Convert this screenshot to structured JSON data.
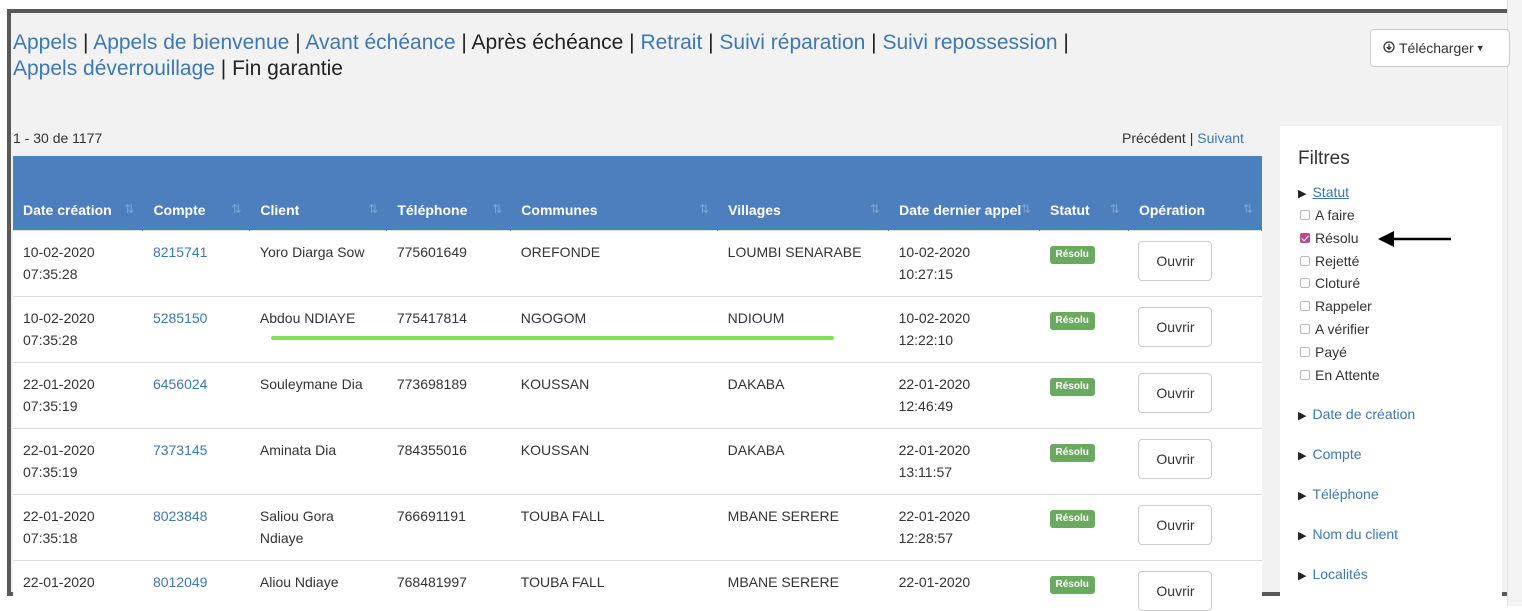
{
  "nav": {
    "items": [
      {
        "label": "Appels",
        "active": false
      },
      {
        "label": "Appels de bienvenue",
        "active": false
      },
      {
        "label": "Avant échéance",
        "active": false
      },
      {
        "label": "Après échéance",
        "active": true
      },
      {
        "label": "Retrait",
        "active": false
      },
      {
        "label": "Suivi réparation",
        "active": false
      },
      {
        "label": "Suivi repossession",
        "active": false
      },
      {
        "label": "Appels déverrouillage",
        "active": false
      },
      {
        "label": "Fin garantie",
        "active": true
      }
    ]
  },
  "download": {
    "label": "Télécharger"
  },
  "pagination": {
    "range": "1 - 30 de 1177",
    "prev": "Précédent",
    "sep": "|",
    "next": "Suivant"
  },
  "table": {
    "headers": [
      "Date création",
      "Compte",
      "Client",
      "Téléphone",
      "Communes",
      "Villages",
      "Date dernier appel",
      "Statut",
      "Opération"
    ],
    "rows": [
      {
        "date_creation": "10-02-2020",
        "time_creation": "07:35:28",
        "compte": "8215741",
        "client": "Yoro Diarga Sow",
        "telephone": "775601649",
        "commune": "OREFONDE",
        "village": "LOUMBI SENARABE",
        "date_appel": "10-02-2020",
        "time_appel": "10:27:15",
        "statut": "Résolu",
        "operation": "Ouvrir"
      },
      {
        "date_creation": "10-02-2020",
        "time_creation": "07:35:28",
        "compte": "5285150",
        "client": "Abdou NDIAYE",
        "telephone": "775417814",
        "commune": "NGOGOM",
        "village": "NDIOUM",
        "date_appel": "10-02-2020",
        "time_appel": "12:22:10",
        "statut": "Résolu",
        "operation": "Ouvrir"
      },
      {
        "date_creation": "22-01-2020",
        "time_creation": "07:35:19",
        "compte": "6456024",
        "client": "Souleymane Dia",
        "telephone": "773698189",
        "commune": "KOUSSAN",
        "village": "DAKABA",
        "date_appel": "22-01-2020",
        "time_appel": "12:46:49",
        "statut": "Résolu",
        "operation": "Ouvrir"
      },
      {
        "date_creation": "22-01-2020",
        "time_creation": "07:35:19",
        "compte": "7373145",
        "client": "Aminata Dia",
        "telephone": "784355016",
        "commune": "KOUSSAN",
        "village": "DAKABA",
        "date_appel": "22-01-2020",
        "time_appel": "13:11:57",
        "statut": "Résolu",
        "operation": "Ouvrir"
      },
      {
        "date_creation": "22-01-2020",
        "time_creation": "07:35:18",
        "compte": "8023848",
        "client": "Saliou Gora Ndiaye",
        "telephone": "766691191",
        "commune": "TOUBA FALL",
        "village": "MBANE SERERE",
        "date_appel": "22-01-2020",
        "time_appel": "12:28:57",
        "statut": "Résolu",
        "operation": "Ouvrir"
      },
      {
        "date_creation": "22-01-2020",
        "time_creation": "",
        "compte": "8012049",
        "client": "Aliou Ndiaye",
        "telephone": "768481997",
        "commune": "TOUBA FALL",
        "village": "MBANE SERERE",
        "date_appel": "22-01-2020",
        "time_appel": "",
        "statut": "Résolu",
        "operation": "Ouvrir"
      }
    ]
  },
  "filters": {
    "title": "Filtres",
    "statut_label": "Statut",
    "options": [
      {
        "label": "A faire",
        "checked": false
      },
      {
        "label": "Résolu",
        "checked": true
      },
      {
        "label": "Rejetté",
        "checked": false
      },
      {
        "label": "Cloturé",
        "checked": false
      },
      {
        "label": "Rappeler",
        "checked": false
      },
      {
        "label": "A vérifier",
        "checked": false
      },
      {
        "label": "Payé",
        "checked": false
      },
      {
        "label": "En Attente",
        "checked": false
      }
    ],
    "sections": [
      "Date de création",
      "Compte",
      "Téléphone",
      "Nom du client",
      "Localités"
    ]
  },
  "colors": {
    "header": "#4d7ebd",
    "link": "#3c78b4",
    "badge": "#6aaa5f",
    "highlight": "#7ee35a",
    "checkbox_on": "#b24f8f"
  }
}
